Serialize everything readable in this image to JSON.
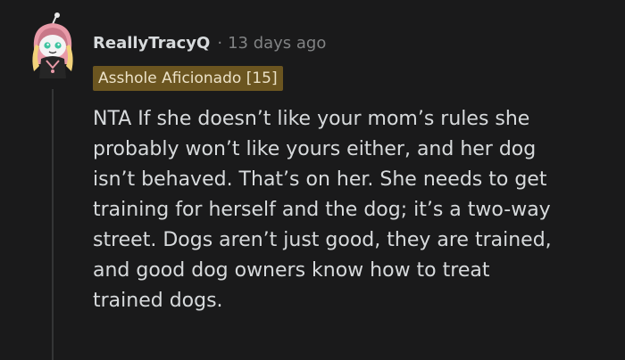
{
  "comment": {
    "username": "ReallyTracyQ",
    "separator": "·",
    "timestamp": "13 days ago",
    "flair": "Asshole Aficionado [15]",
    "body_lines": [
      "NTA If she doesn’t like your mom’s rules she",
      "probably won’t like yours either, and her dog",
      "isn’t behaved. That’s on her. She needs to get",
      "training for herself and the dog; it’s a two-way",
      "street. Dogs aren’t just good, they are trained,",
      "and good dog owners know how to treat",
      "trained dogs."
    ]
  },
  "colors": {
    "background": "#1a1a1b",
    "text": "#d7dadc",
    "meta": "#818384",
    "flair_bg": "#6b5520",
    "avatar_pink": "#e89aa8"
  },
  "icons": {
    "avatar": "snoo-avatar-pink-hood"
  }
}
